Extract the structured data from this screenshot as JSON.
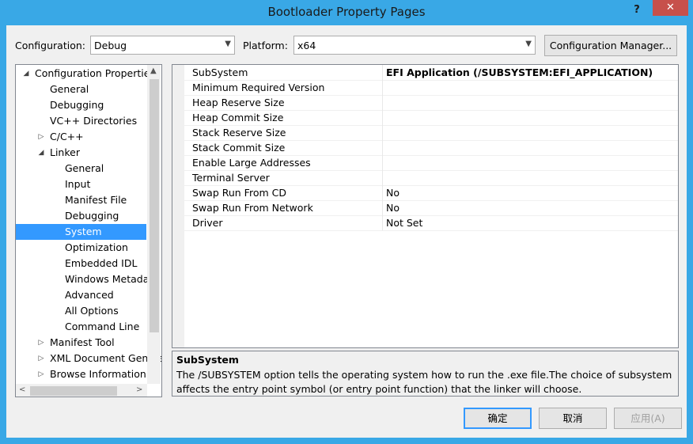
{
  "window": {
    "title": "Bootloader Property Pages",
    "help_glyph": "?",
    "close_glyph": "✕"
  },
  "toolbar": {
    "configuration_label": "Configuration:",
    "configuration_value": "Debug",
    "platform_label": "Platform:",
    "platform_value": "x64",
    "config_manager_label": "Configuration Manager..."
  },
  "tree": {
    "items": [
      {
        "label": "Configuration Properties",
        "expander": "◢"
      },
      {
        "label": "General"
      },
      {
        "label": "Debugging"
      },
      {
        "label": "VC++ Directories"
      },
      {
        "label": "C/C++",
        "expander": "▷"
      },
      {
        "label": "Linker",
        "expander": "◢"
      },
      {
        "label": "General"
      },
      {
        "label": "Input"
      },
      {
        "label": "Manifest File"
      },
      {
        "label": "Debugging"
      },
      {
        "label": "System",
        "selected": true
      },
      {
        "label": "Optimization"
      },
      {
        "label": "Embedded IDL"
      },
      {
        "label": "Windows Metadata"
      },
      {
        "label": "Advanced"
      },
      {
        "label": "All Options"
      },
      {
        "label": "Command Line"
      },
      {
        "label": "Manifest Tool",
        "expander": "▷"
      },
      {
        "label": "XML Document Generator",
        "expander": "▷"
      },
      {
        "label": "Browse Information",
        "expander": "▷"
      }
    ]
  },
  "properties": [
    {
      "name": "SubSystem",
      "value": "EFI Application (/SUBSYSTEM:EFI_APPLICATION)"
    },
    {
      "name": "Minimum Required Version",
      "value": ""
    },
    {
      "name": "Heap Reserve Size",
      "value": ""
    },
    {
      "name": "Heap Commit Size",
      "value": ""
    },
    {
      "name": "Stack Reserve Size",
      "value": ""
    },
    {
      "name": "Stack Commit Size",
      "value": ""
    },
    {
      "name": "Enable Large Addresses",
      "value": ""
    },
    {
      "name": "Terminal Server",
      "value": ""
    },
    {
      "name": "Swap Run From CD",
      "value": "No"
    },
    {
      "name": "Swap Run From Network",
      "value": "No"
    },
    {
      "name": "Driver",
      "value": "Not Set"
    }
  ],
  "description": {
    "title": "SubSystem",
    "text": "The /SUBSYSTEM option tells the operating system how to run the .exe file.The choice of subsystem affects the entry point symbol (or entry point function) that the linker will choose."
  },
  "buttons": {
    "ok": "确定",
    "cancel": "取消",
    "apply": "应用(A)"
  },
  "colors": {
    "title_bar": "#39a8e6",
    "selection": "#3399ff",
    "close": "#c7504b"
  }
}
